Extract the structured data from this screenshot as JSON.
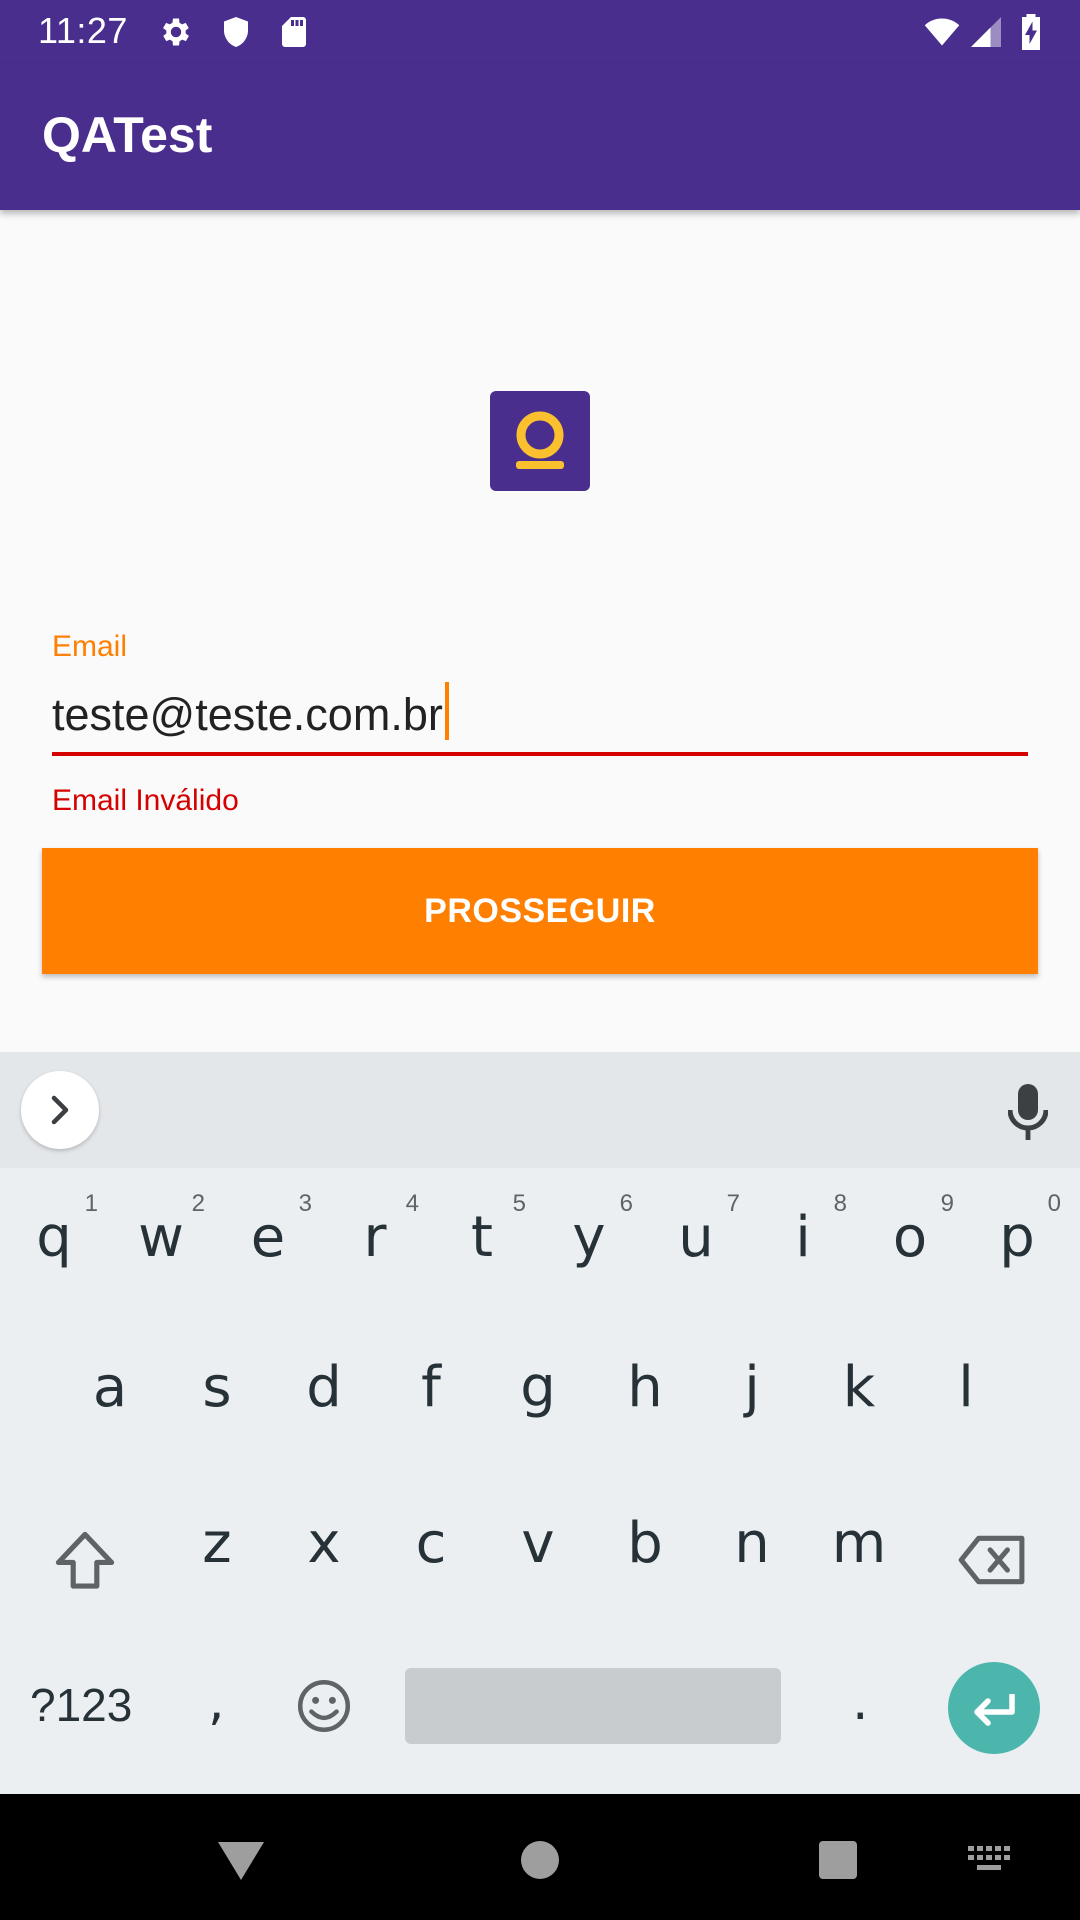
{
  "status_bar": {
    "time": "11:27",
    "left_icons": [
      "gear-icon",
      "shield-icon",
      "sd-card-icon"
    ],
    "right_icons": [
      "wifi-icon",
      "signal-icon",
      "battery-charging-icon"
    ]
  },
  "app_bar": {
    "title": "QATest"
  },
  "form": {
    "email_label": "Email",
    "email_value": "teste@teste.com.br",
    "error_text": "Email Inválido",
    "button_label": "PROSSEGUIR"
  },
  "colors": {
    "primary": "#4A2E8E",
    "accent": "#FF7F00",
    "error": "#D50000",
    "logo_figure": "#FBC02D",
    "keyboard_enter": "#4DB6AC"
  },
  "keyboard": {
    "row1": [
      {
        "key": "q",
        "hint": "1"
      },
      {
        "key": "w",
        "hint": "2"
      },
      {
        "key": "e",
        "hint": "3"
      },
      {
        "key": "r",
        "hint": "4"
      },
      {
        "key": "t",
        "hint": "5"
      },
      {
        "key": "y",
        "hint": "6"
      },
      {
        "key": "u",
        "hint": "7"
      },
      {
        "key": "i",
        "hint": "8"
      },
      {
        "key": "o",
        "hint": "9"
      },
      {
        "key": "p",
        "hint": "0"
      }
    ],
    "row2": [
      "a",
      "s",
      "d",
      "f",
      "g",
      "h",
      "j",
      "k",
      "l"
    ],
    "row3": [
      "z",
      "x",
      "c",
      "v",
      "b",
      "n",
      "m"
    ],
    "symbols_label": "?123",
    "comma": ",",
    "period": "."
  }
}
